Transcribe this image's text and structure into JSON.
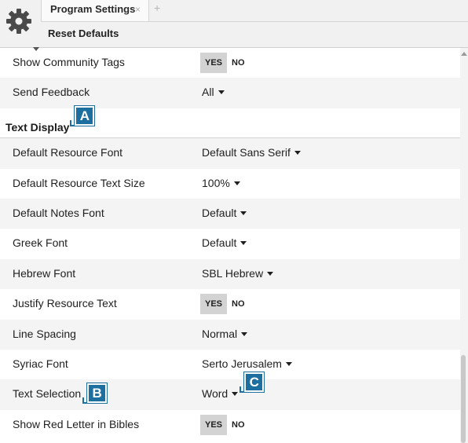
{
  "toolbar": {
    "gear_icon": "gear-icon",
    "tab_label": "Program Settings",
    "tab_close": "×",
    "tab_add": "+",
    "reset_label": "Reset Defaults"
  },
  "rows_top": [
    {
      "label": "Show Community Tags",
      "type": "toggle",
      "yes": "YES",
      "no": "NO",
      "selected": "YES"
    },
    {
      "label": "Send Feedback",
      "type": "dropdown",
      "value": "All"
    }
  ],
  "section": {
    "title": "Text Display"
  },
  "rows": [
    {
      "label": "Default Resource Font",
      "type": "dropdown",
      "value": "Default Sans Serif"
    },
    {
      "label": "Default Resource Text Size",
      "type": "dropdown",
      "value": "100%"
    },
    {
      "label": "Default Notes Font",
      "type": "dropdown",
      "value": "Default"
    },
    {
      "label": "Greek Font",
      "type": "dropdown",
      "value": "Default"
    },
    {
      "label": "Hebrew Font",
      "type": "dropdown",
      "value": "SBL Hebrew"
    },
    {
      "label": "Justify Resource Text",
      "type": "toggle",
      "yes": "YES",
      "no": "NO",
      "selected": "YES"
    },
    {
      "label": "Line Spacing",
      "type": "dropdown",
      "value": "Normal"
    },
    {
      "label": "Syriac Font",
      "type": "dropdown",
      "value": "Serto Jerusalem"
    },
    {
      "label": "Text Selection",
      "type": "dropdown",
      "value": "Word"
    },
    {
      "label": "Show Red Letter in Bibles",
      "type": "toggle",
      "yes": "YES",
      "no": "NO",
      "selected": "YES"
    }
  ],
  "callouts": {
    "a": "A",
    "b": "B",
    "c": "C"
  },
  "colors": {
    "callout": "#1d6fa0",
    "toggle_on": "#d3d3d3",
    "alt_row": "#f4f4f4"
  }
}
